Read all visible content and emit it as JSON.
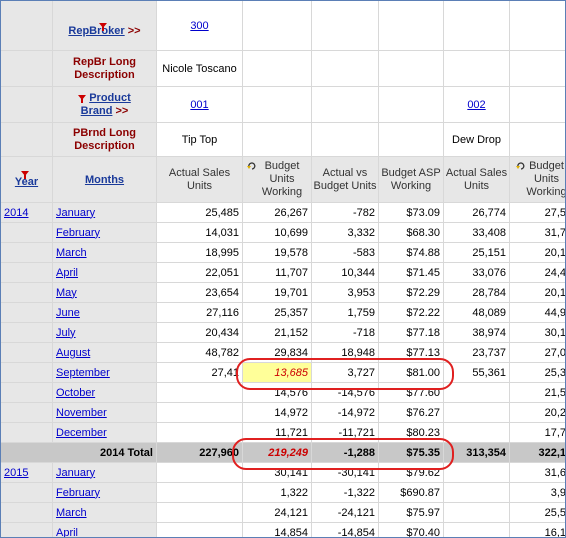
{
  "header": {
    "repbroker": {
      "label": "RepBroker",
      "arrow": ">>",
      "values": [
        "300",
        "",
        "",
        "",
        "",
        ""
      ]
    },
    "repbr_desc": {
      "label": "RepBr Long Description",
      "values": [
        "Nicole Toscano",
        "",
        "",
        "",
        "",
        ""
      ]
    },
    "brand": {
      "label_1": "Product",
      "label_2": "Brand",
      "arrow": ">>",
      "values": [
        "001",
        "",
        "",
        "",
        "002",
        ""
      ]
    },
    "brand_desc": {
      "label": "PBrnd Long Description",
      "values": [
        "Tip Top",
        "",
        "",
        "",
        "Dew Drop",
        ""
      ]
    }
  },
  "columns": {
    "year": "Year",
    "months": "Months",
    "measures": [
      "Actual Sales Units",
      "Budget Units Working",
      "Actual vs Budget Units",
      "Budget ASP Working",
      "Actual Sales Units",
      "Budget Units Working"
    ]
  },
  "rows": [
    {
      "year": "2014",
      "month": "January",
      "v": [
        "25,485",
        "26,267",
        "-782",
        "$73.09",
        "26,774",
        "27,5"
      ]
    },
    {
      "year": "",
      "month": "February",
      "v": [
        "14,031",
        "10,699",
        "3,332",
        "$68.30",
        "33,408",
        "31,7"
      ]
    },
    {
      "year": "",
      "month": "March",
      "v": [
        "18,995",
        "19,578",
        "-583",
        "$74.88",
        "25,151",
        "20,1"
      ]
    },
    {
      "year": "",
      "month": "April",
      "v": [
        "22,051",
        "11,707",
        "10,344",
        "$71.45",
        "33,076",
        "24,4"
      ]
    },
    {
      "year": "",
      "month": "May",
      "v": [
        "23,654",
        "19,701",
        "3,953",
        "$72.29",
        "28,784",
        "20,1"
      ]
    },
    {
      "year": "",
      "month": "June",
      "v": [
        "27,116",
        "25,357",
        "1,759",
        "$72.22",
        "48,089",
        "44,9"
      ]
    },
    {
      "year": "",
      "month": "July",
      "v": [
        "20,434",
        "21,152",
        "-718",
        "$77.18",
        "38,974",
        "30,1"
      ]
    },
    {
      "year": "",
      "month": "August",
      "v": [
        "48,782",
        "29,834",
        "18,948",
        "$77.13",
        "23,737",
        "27,0"
      ]
    },
    {
      "year": "",
      "month": "September",
      "v": [
        "27,41",
        "13,685",
        "3,727",
        "$81.00",
        "55,361",
        "25,3"
      ]
    },
    {
      "year": "",
      "month": "October",
      "v": [
        "",
        "14,576",
        "-14,576",
        "$77.60",
        "",
        "21,5"
      ]
    },
    {
      "year": "",
      "month": "November",
      "v": [
        "",
        "14,972",
        "-14,972",
        "$76.27",
        "",
        "20,2"
      ]
    },
    {
      "year": "",
      "month": "December",
      "v": [
        "",
        "11,721",
        "-11,721",
        "$80.23",
        "",
        "17,7"
      ]
    }
  ],
  "total": {
    "label": "2014 Total",
    "v": [
      "227,960",
      "219,249",
      "-1,288",
      "$75.35",
      "313,354",
      "322,1"
    ]
  },
  "rows_2015": [
    {
      "year": "2015",
      "month": "January",
      "v": [
        "",
        "30,141",
        "-30,141",
        "$79.62",
        "",
        "31,6"
      ]
    },
    {
      "year": "",
      "month": "February",
      "v": [
        "",
        "1,322",
        "-1,322",
        "$690.87",
        "",
        "3,9"
      ]
    },
    {
      "year": "",
      "month": "March",
      "v": [
        "",
        "24,121",
        "-24,121",
        "$75.97",
        "",
        "25,5"
      ]
    },
    {
      "year": "",
      "month": "April",
      "v": [
        "",
        "14,854",
        "-14,854",
        "$70.40",
        "",
        "16,1"
      ]
    }
  ],
  "colors": {
    "highlight": "#ffff99",
    "oval": "#e02020",
    "link": "#0000cc",
    "maroon": "#8b0000"
  }
}
